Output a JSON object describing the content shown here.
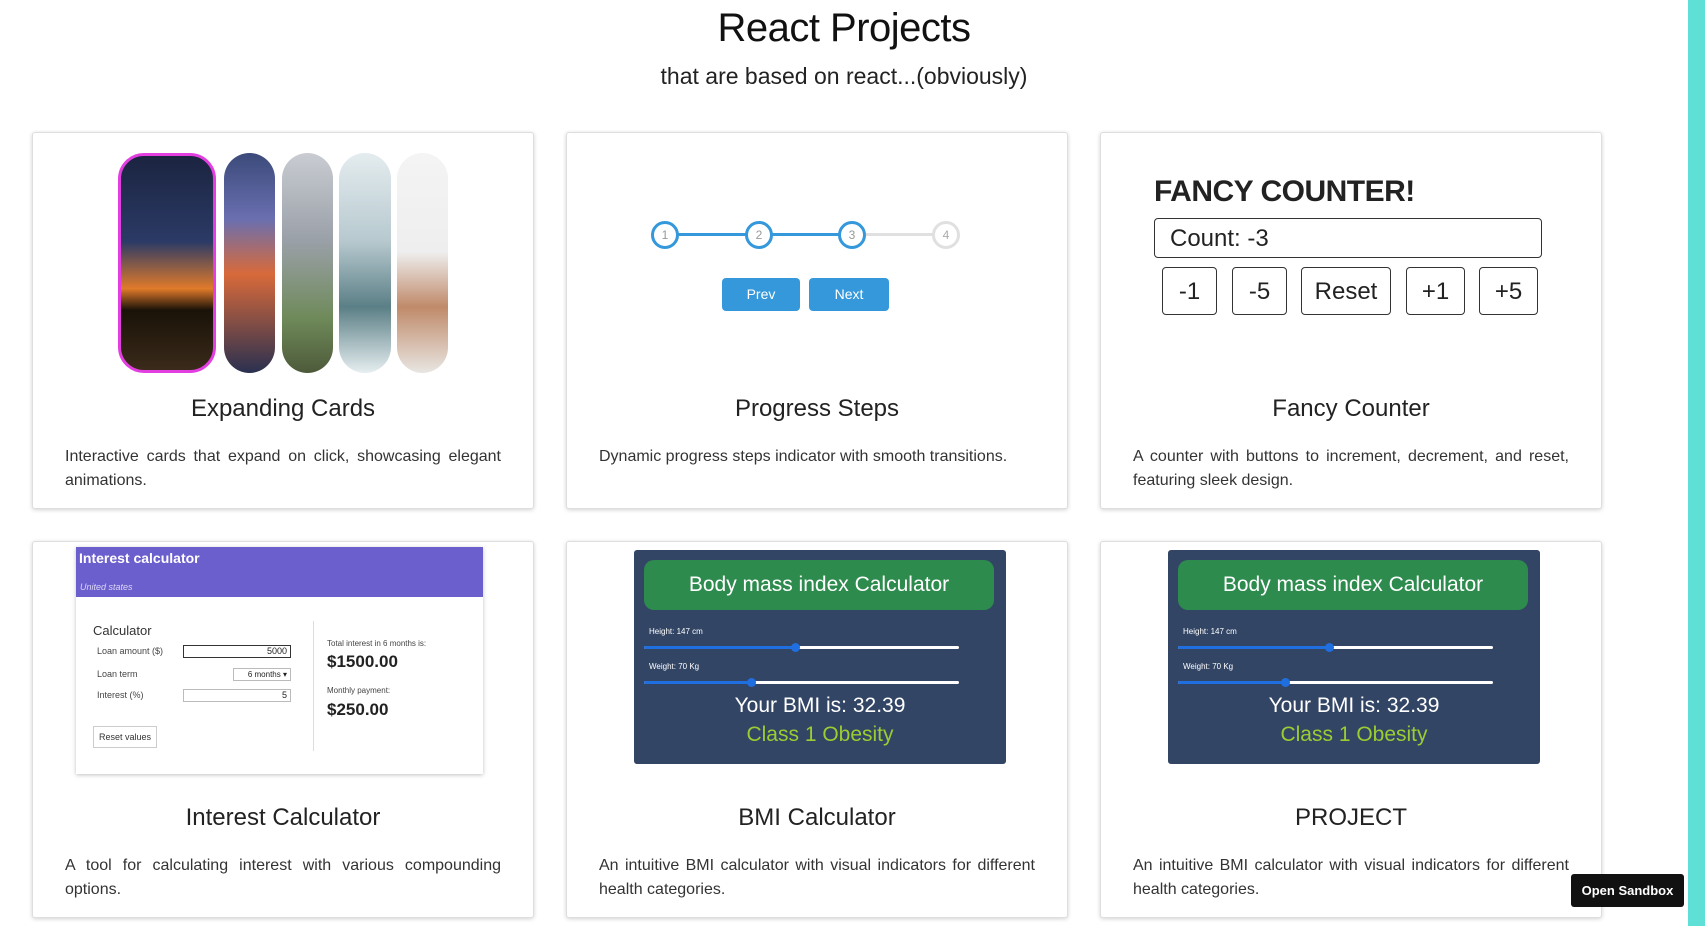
{
  "header": {
    "title": "React Projects",
    "subtitle": "that are based on react...(obviously)"
  },
  "projects": [
    {
      "title": "Expanding Cards",
      "description": "Interactive cards that expand on click, showcasing elegant animations."
    },
    {
      "title": "Progress Steps",
      "description": "Dynamic progress steps indicator with smooth transitions."
    },
    {
      "title": "Fancy Counter",
      "description": "A counter with buttons to increment, decrement, and reset, featuring sleek design."
    },
    {
      "title": "Interest Calculator",
      "description": "A tool for calculating interest with various compounding options."
    },
    {
      "title": "BMI Calculator",
      "description": "An intuitive BMI calculator with visual indicators for different health categories."
    },
    {
      "title": "PROJECT",
      "description": "An intuitive BMI calculator with visual indicators for different health categories."
    }
  ],
  "progress_steps": {
    "steps": [
      "1",
      "2",
      "3",
      "4"
    ],
    "prev_label": "Prev",
    "next_label": "Next"
  },
  "fancy_counter": {
    "title": "FANCY COUNTER!",
    "count_text": "Count: -3",
    "buttons": [
      "-1",
      "-5",
      "Reset",
      "+1",
      "+5"
    ]
  },
  "interest_calculator": {
    "header_title": "Interest calculator",
    "header_subtitle": "United states",
    "section_title": "Calculator",
    "loan_amount_label": "Loan amount ($)",
    "loan_amount_value": "5000",
    "loan_term_label": "Loan term",
    "loan_term_value": "6 months",
    "interest_label": "Interest (%)",
    "interest_value": "5",
    "total_interest_label": "Total interest in 6 months is:",
    "total_interest_value": "$1500.00",
    "monthly_payment_label": "Monthly payment:",
    "monthly_payment_value": "$250.00",
    "reset_label": "Reset values"
  },
  "bmi_calculator": {
    "title": "Body mass index Calculator",
    "height_label": "Height: 147 cm",
    "weight_label": "Weight: 70 Kg",
    "height_level": 0.48,
    "weight_level": 0.34,
    "result": "Your BMI is: 32.39",
    "class": "Class 1 Obesity"
  },
  "sandbox_label": "Open Sandbox",
  "colors": {
    "accent_strip": "#5fe0d6",
    "progress_blue": "#3498db",
    "bmi_panel": "#324565",
    "bmi_header": "#2e8b4e",
    "bmi_class": "#9acd32",
    "interest_header": "#6b5ecd"
  }
}
